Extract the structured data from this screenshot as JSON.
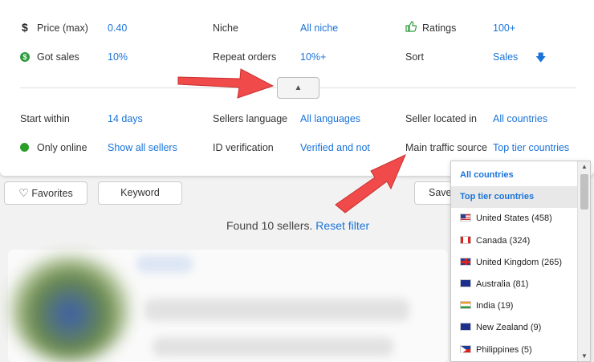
{
  "filters": {
    "price_label": "Price (max)",
    "price_value": "0.40",
    "niche_label": "Niche",
    "niche_value": "All niche",
    "ratings_label": "Ratings",
    "ratings_value": "100+",
    "got_sales_label": "Got sales",
    "got_sales_value": "10%",
    "repeat_orders_label": "Repeat orders",
    "repeat_orders_value": "10%+",
    "sort_label": "Sort",
    "sort_value": "Sales",
    "start_within_label": "Start within",
    "start_within_value": "14 days",
    "sellers_language_label": "Sellers language",
    "sellers_language_value": "All languages",
    "seller_located_label": "Seller located in",
    "seller_located_value": "All countries",
    "only_online_label": "Only online",
    "only_online_value": "Show all sellers",
    "id_verification_label": "ID verification",
    "id_verification_value": "Verified and not",
    "traffic_source_label": "Main traffic source",
    "traffic_source_value": "Top tier countries",
    "collapse_glyph": "▲",
    "sort_arrow": "🡇"
  },
  "toolbar": {
    "favorites_label": "Favorites",
    "favorites_icon": "♡",
    "keyword_label": "Keyword",
    "save_label": "Save"
  },
  "results": {
    "found_text": "Found 10 sellers.",
    "reset_label": "Reset filter"
  },
  "dropdown": {
    "items": [
      {
        "label": "All countries",
        "flag": ""
      },
      {
        "label": "Top tier countries",
        "flag": ""
      },
      {
        "label": "United States (458)",
        "flag": "us"
      },
      {
        "label": "Canada (324)",
        "flag": "ca"
      },
      {
        "label": "United Kingdom (265)",
        "flag": "gb"
      },
      {
        "label": "Australia (81)",
        "flag": "au"
      },
      {
        "label": "India (19)",
        "flag": "in"
      },
      {
        "label": "New Zealand (9)",
        "flag": "nz"
      },
      {
        "label": "Philippines (5)",
        "flag": "ph"
      }
    ],
    "selected": "Top tier countries"
  },
  "colors": {
    "link": "#1a73d9",
    "online_dot": "#28a028",
    "annotation_arrow": "#f04a4a"
  }
}
